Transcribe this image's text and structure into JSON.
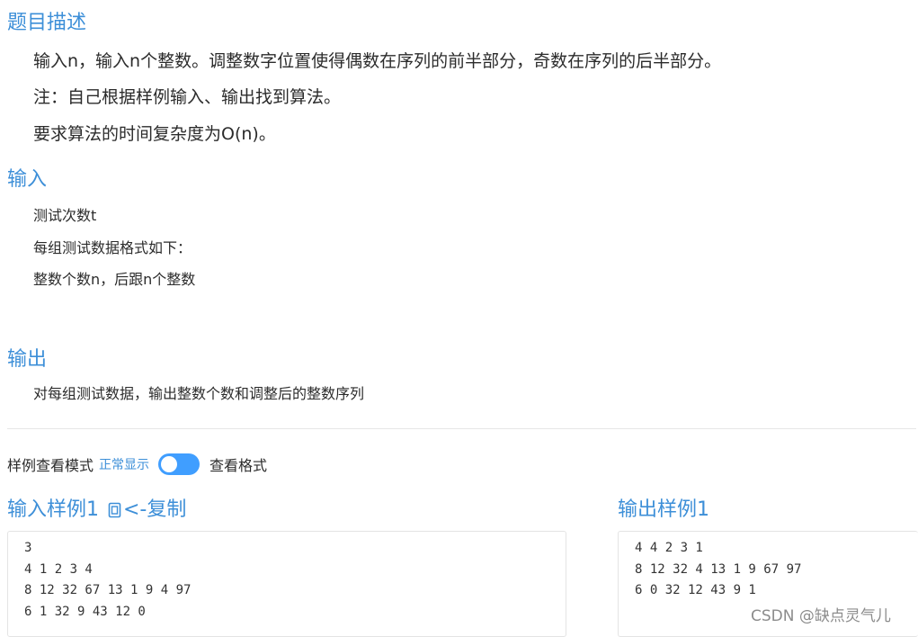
{
  "description": {
    "title": "题目描述",
    "lines": [
      "输入n，输入n个整数。调整数字位置使得偶数在序列的前半部分，奇数在序列的后半部分。",
      "注：自己根据样例输入、输出找到算法。",
      "要求算法的时间复杂度为O(n)。"
    ]
  },
  "input": {
    "title": "输入",
    "lines": [
      "测试次数t",
      "每组测试数据格式如下：",
      "整数个数n，后跟n个整数"
    ]
  },
  "output": {
    "title": "输出",
    "lines": [
      "对每组测试数据，输出整数个数和调整后的整数序列"
    ]
  },
  "mode": {
    "label": "样例查看模式",
    "normal": "正常显示",
    "toggle_on": true,
    "format": "查看格式"
  },
  "sample_input": {
    "title": "输入样例1",
    "copy_label": "<-复制",
    "lines": [
      "3",
      "4 1 2 3 4",
      "8 12 32 67 13 1 9 4 97",
      "6 1 32 9 43 12 0"
    ]
  },
  "sample_output": {
    "title": "输出样例1",
    "lines": [
      "4 4 2 3 1",
      "8 12 32 4 13 1 9 67 97",
      "6 0 32 12 43 9 1"
    ]
  },
  "watermark": "CSDN @缺点灵气儿",
  "colors": {
    "accent": "#3d8fd8",
    "toggle": "#409eff"
  }
}
